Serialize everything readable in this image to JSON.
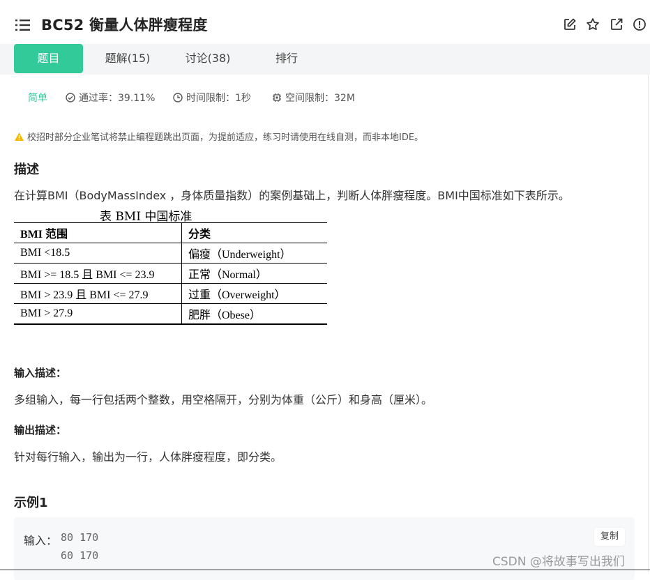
{
  "header": {
    "title": "BC52  衡量人体胖瘦程度",
    "icons": [
      "edit-icon",
      "star-icon",
      "share-icon",
      "report-icon"
    ]
  },
  "tabs": [
    {
      "label": "题目",
      "active": true
    },
    {
      "label": "题解(15)",
      "active": false
    },
    {
      "label": "讨论(38)",
      "active": false
    },
    {
      "label": "排行",
      "active": false
    }
  ],
  "meta": {
    "difficulty": "简单",
    "pass_rate": "通过率：39.11%",
    "time_limit": "时间限制：1秒",
    "space_limit": "空间限制：32M"
  },
  "notice": "校招时部分企业笔试将禁止编程题跳出页面，为提前适应，练习时请使用在线自测，而非本地IDE。",
  "description": {
    "heading": "描述",
    "text": "在计算BMI（BodyMassIndex ，身体质量指数）的案例基础上，判断人体胖瘦程度。BMI中国标准如下表所示。",
    "table": {
      "caption": "表 BMI 中国标准",
      "headers": [
        "BMI 范围",
        "分类"
      ],
      "rows": [
        [
          "BMI <18.5",
          "偏瘦（Underweight）"
        ],
        [
          "BMI >= 18.5 且 BMI <= 23.9",
          "正常（Normal）"
        ],
        [
          "BMI > 23.9 且 BMI <= 27.9",
          "过重（Overweight）"
        ],
        [
          "BMI > 27.9",
          "肥胖（Obese）"
        ]
      ]
    }
  },
  "input_desc": {
    "heading": "输入描述：",
    "text": "多组输入，每一行包括两个整数，用空格隔开，分别为体重（公斤）和身高（厘米）。"
  },
  "output_desc": {
    "heading": "输出描述：",
    "text": "针对每行输入，输出为一行，人体胖瘦程度，即分类。"
  },
  "example": {
    "heading": "示例1",
    "input_label": "输入：",
    "lines": [
      "80 170",
      "60 170"
    ],
    "copy_label": "复制"
  },
  "watermark": "CSDN @将故事写出我们",
  "colors": {
    "accent": "#32ca99",
    "warning": "#f5b800"
  }
}
